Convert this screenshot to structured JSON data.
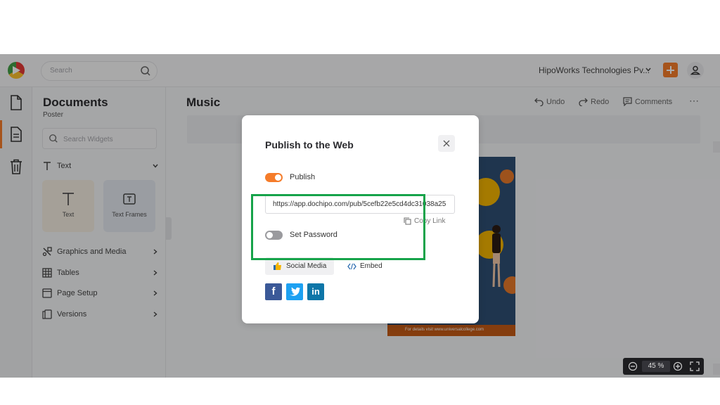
{
  "topbar": {
    "search_placeholder": "Search",
    "company_name": "HipoWorks Technologies Pv...",
    "icons": [
      "dochipo-logo",
      "search-icon",
      "chevron-down-icon",
      "plus-icon",
      "user-icon"
    ]
  },
  "rail": {
    "items": [
      {
        "name": "documents",
        "icon": "document-icon"
      },
      {
        "name": "templates",
        "icon": "page-text-icon",
        "active": true
      },
      {
        "name": "trash",
        "icon": "trash-icon"
      }
    ]
  },
  "panel": {
    "title": "Documents",
    "subtitle": "Poster",
    "search_placeholder": "Search Widgets",
    "text_section": "Text",
    "tiles": [
      {
        "label": "Text",
        "color": "#f3ece1"
      },
      {
        "label": "Text Frames",
        "color": "#e3e7ef"
      }
    ],
    "sections": [
      "Graphics and Media",
      "Tables",
      "Page Setup",
      "Versions"
    ]
  },
  "canvas": {
    "title": "Music",
    "toolbar": {
      "undo": "Undo",
      "redo": "Redo",
      "comments": "Comments",
      "more": "⋯"
    },
    "poster_footer": "For details visit www.universalcollege.com"
  },
  "zoom": {
    "value": "45",
    "unit": "%"
  },
  "modal": {
    "title": "Publish to the Web",
    "publish_label": "Publish",
    "publish_on": true,
    "url": "https://app.dochipo.com/pub/5cefb22e5cd4dc31038a25",
    "copy_link": "Copy Link",
    "password_label": "Set Password",
    "password_on": false,
    "tabs": {
      "social": "Social Media",
      "embed": "Embed"
    },
    "social_buttons": [
      {
        "name": "facebook",
        "glyph": "f",
        "color": "#3b5998"
      },
      {
        "name": "twitter",
        "glyph": "",
        "color": "#1da1f2"
      },
      {
        "name": "linkedin",
        "glyph": "in",
        "color": "#0e76a8"
      }
    ]
  },
  "colors": {
    "accent": "#f57c2a",
    "highlight": "#16a34a"
  }
}
